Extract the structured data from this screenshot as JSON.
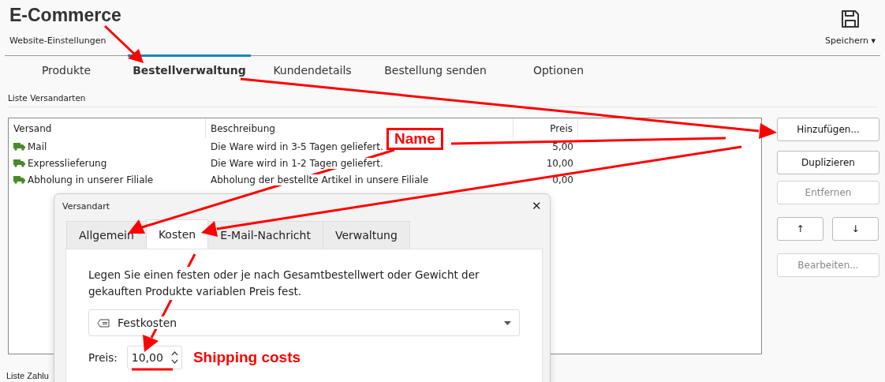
{
  "header": {
    "title": "E-Commerce",
    "subtitle": "Website-Einstellungen",
    "save_label": "Speichern",
    "save_caret": "▾"
  },
  "tabs": [
    {
      "label": "Produkte",
      "selected": false
    },
    {
      "label": "Bestellverwaltung",
      "selected": true
    },
    {
      "label": "Kundendetails",
      "selected": false
    },
    {
      "label": "Bestellung senden",
      "selected": false
    },
    {
      "label": "Optionen",
      "selected": false
    }
  ],
  "shipping_section": {
    "title": "Liste Versandarten",
    "columns": [
      "Versand",
      "Beschreibung",
      "Preis"
    ],
    "rows": [
      {
        "name": "Mail",
        "description": "Die Ware wird in 3-5 Tagen geliefert.",
        "price": "5,00"
      },
      {
        "name": "Expresslieferung",
        "description": "Die Ware wird in 1-2 Tagen geliefert.",
        "price": "10,00"
      },
      {
        "name": "Abholung in unserer Filiale",
        "description": "Abholung der bestellte Artikel in unsere Filiale",
        "price": "0,00"
      }
    ],
    "buttons": [
      {
        "label": "Hinzufügen...",
        "disabled": false,
        "kind": "wide"
      },
      {
        "label": "Duplizieren",
        "disabled": false,
        "kind": "wide"
      },
      {
        "label": "Entfernen",
        "disabled": true,
        "kind": "wide"
      },
      {
        "label": "↑",
        "disabled": false,
        "kind": "half"
      },
      {
        "label": "↓",
        "disabled": false,
        "kind": "half"
      },
      {
        "label": "Bearbeiten...",
        "disabled": true,
        "kind": "wide"
      }
    ]
  },
  "payment_section": {
    "title": "Liste Zahlu"
  },
  "dialog": {
    "title": "Versandart",
    "close": "✕",
    "tabs": [
      {
        "label": "Allgemein",
        "selected": false
      },
      {
        "label": "Kosten",
        "selected": true
      },
      {
        "label": "E-Mail-Nachricht",
        "selected": false
      },
      {
        "label": "Verwaltung",
        "selected": false
      }
    ],
    "description": "Legen Sie einen festen oder je nach Gesamtbestellwert oder Gewicht der gekauften Produkte variablen Preis fest.",
    "cost_type": "Festkosten",
    "price_label": "Preis:",
    "price_value": "10,00"
  },
  "callouts": [
    {
      "text": "Name",
      "kind": "boxed"
    },
    {
      "text": "Shipping costs",
      "kind": "plain"
    }
  ]
}
